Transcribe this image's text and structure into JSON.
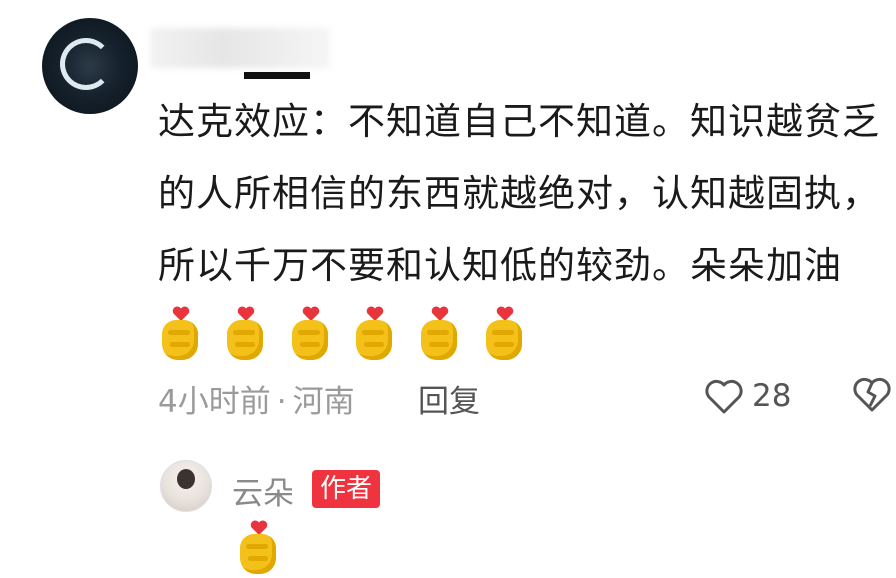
{
  "comment": {
    "text": "达克效应：不知道自己不知道。知识越贫乏的人所相信的东西就越绝对，认知越固执，所以千万不要和认知低的较劲。朵朵加油",
    "emojis": [
      "heart-hand-emoji",
      "heart-hand-emoji",
      "heart-hand-emoji",
      "heart-hand-emoji",
      "heart-hand-emoji",
      "heart-hand-emoji"
    ],
    "time": "4小时前",
    "separator": "·",
    "location": "河南",
    "reply_label": "回复",
    "like_count": "28"
  },
  "reply": {
    "author": "云朵",
    "badge": "作者",
    "emojis": [
      "heart-hand-emoji"
    ]
  },
  "colors": {
    "badge": "#f0343f",
    "meta": "#9a9a9a",
    "emoji_heart": "#e8343c",
    "emoji_hand": "#f4c01a"
  }
}
